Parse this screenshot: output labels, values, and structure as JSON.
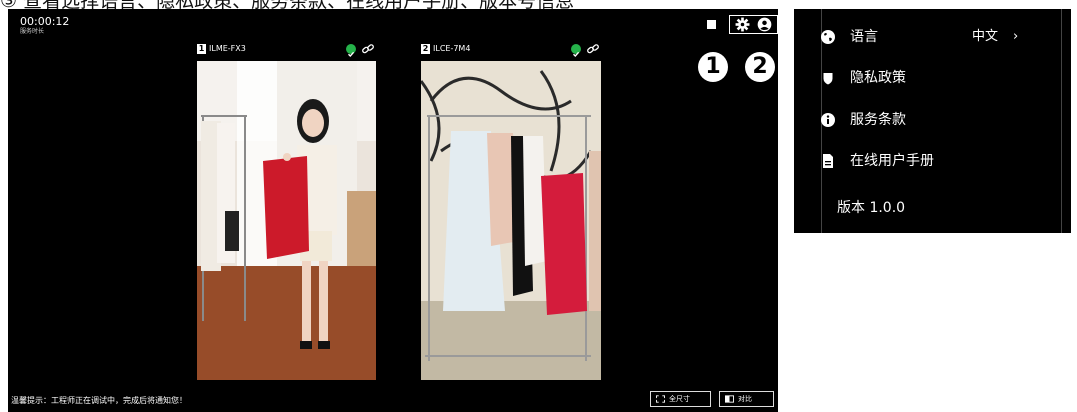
{
  "caption": "③ 查看选择语言、隐私政策、服务条款、在线用户手册、版本号信息",
  "app": {
    "timer": {
      "time": "00:00:12",
      "label": "服务时长"
    },
    "callouts": [
      "1",
      "2"
    ],
    "cameras": [
      {
        "index": "1",
        "name": "ILME-FX3"
      },
      {
        "index": "2",
        "name": "ILCE-7M4"
      }
    ],
    "hint": "温馨提示：工程师正在调试中，完成后将通知您！",
    "buttons": {
      "fullsize": "全尺寸",
      "compare": "对比"
    }
  },
  "menu": {
    "items": [
      {
        "icon": "globe-icon",
        "label": "语言",
        "value": "中文",
        "chevron": "›"
      },
      {
        "icon": "shield-icon",
        "label": "隐私政策"
      },
      {
        "icon": "info-icon",
        "label": "服务条款"
      },
      {
        "icon": "document-icon",
        "label": "在线用户手册"
      }
    ],
    "version": "版本 1.0.0"
  },
  "colors": {
    "status_ok": "#25b24a",
    "panel_bg": "#000000",
    "text": "#ffffff"
  }
}
